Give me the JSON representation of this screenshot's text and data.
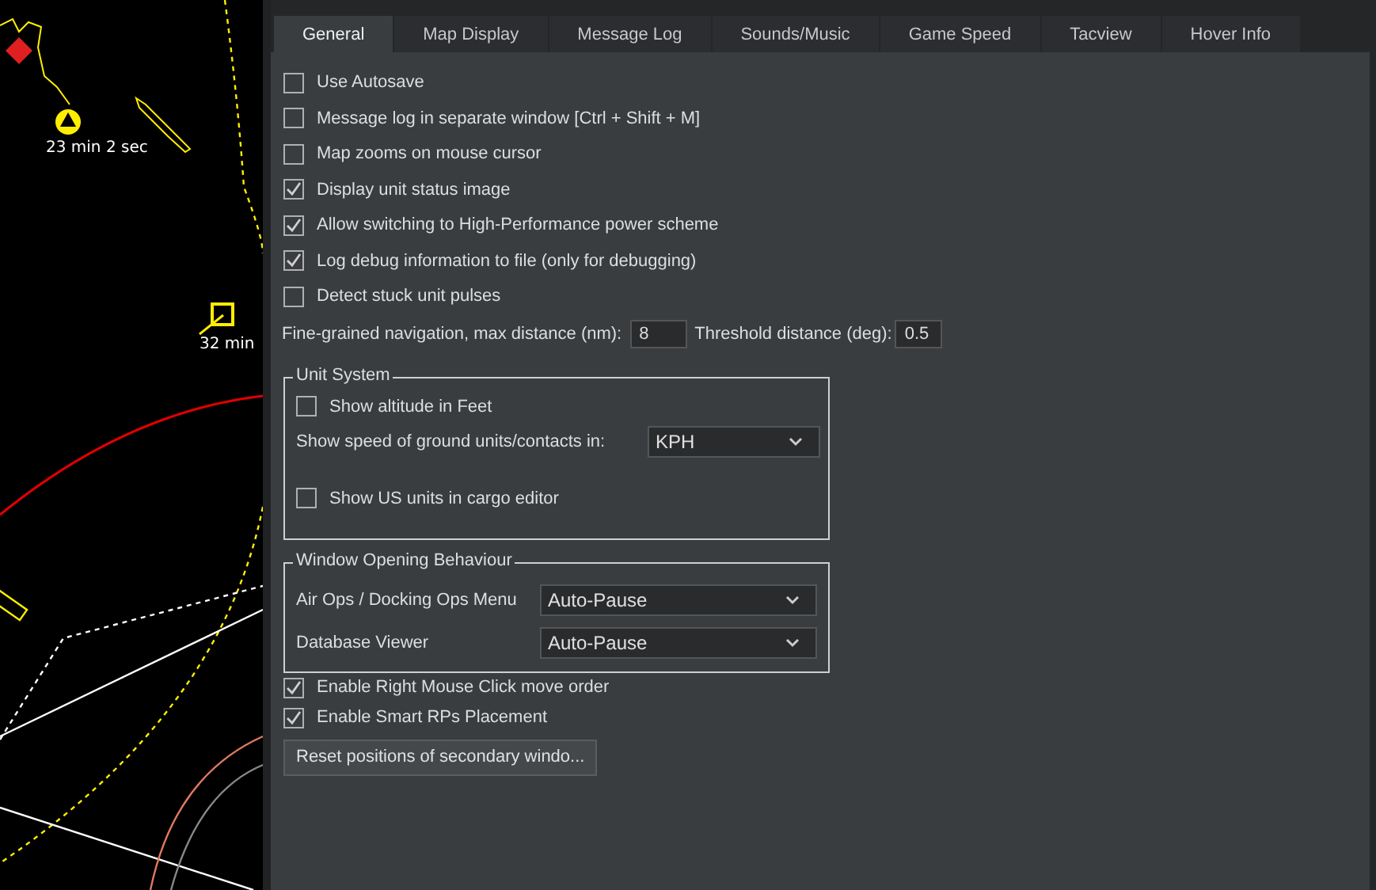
{
  "map": {
    "labels": [
      {
        "text": "23 min 2 sec"
      },
      {
        "text": "32 min"
      }
    ]
  },
  "tabs": [
    {
      "label": "General",
      "selected": true
    },
    {
      "label": "Map Display",
      "selected": false
    },
    {
      "label": "Message Log",
      "selected": false
    },
    {
      "label": "Sounds/Music",
      "selected": false
    },
    {
      "label": "Game Speed",
      "selected": false
    },
    {
      "label": "Tacview",
      "selected": false
    },
    {
      "label": "Hover Info",
      "selected": false
    }
  ],
  "options": [
    {
      "label": "Use Autosave",
      "checked": false
    },
    {
      "label": "Message log in separate window [Ctrl + Shift + M]",
      "checked": false
    },
    {
      "label": "Map zooms on mouse cursor",
      "checked": false
    },
    {
      "label": "Display unit status image",
      "checked": true
    },
    {
      "label": "Allow switching to High-Performance power scheme",
      "checked": true
    },
    {
      "label": "Log debug information to file (only for debugging)",
      "checked": true
    },
    {
      "label": "Detect stuck unit pulses",
      "checked": false
    }
  ],
  "navigation": {
    "label": "Fine-grained navigation, max distance (nm):",
    "value": "8",
    "threshold_label": "Threshold distance (deg):",
    "threshold_value": "0.5"
  },
  "unit_system": {
    "title": "Unit System",
    "altitude": {
      "label": "Show altitude in Feet",
      "checked": false
    },
    "speed": {
      "label": "Show speed of ground units/contacts in:",
      "value": "KPH"
    },
    "cargo": {
      "label": "Show US units in cargo editor",
      "checked": false
    }
  },
  "window_opening": {
    "title": "Window Opening Behaviour",
    "rows": [
      {
        "label": "Air Ops / Docking Ops Menu",
        "value": "Auto-Pause"
      },
      {
        "label": "Database Viewer",
        "value": "Auto-Pause"
      }
    ]
  },
  "bottom_options": [
    {
      "label": "Enable Right Mouse Click move order",
      "checked": true
    },
    {
      "label": "Enable Smart RPs Placement",
      "checked": true
    }
  ],
  "reset_button": "Reset positions of secondary windo..."
}
